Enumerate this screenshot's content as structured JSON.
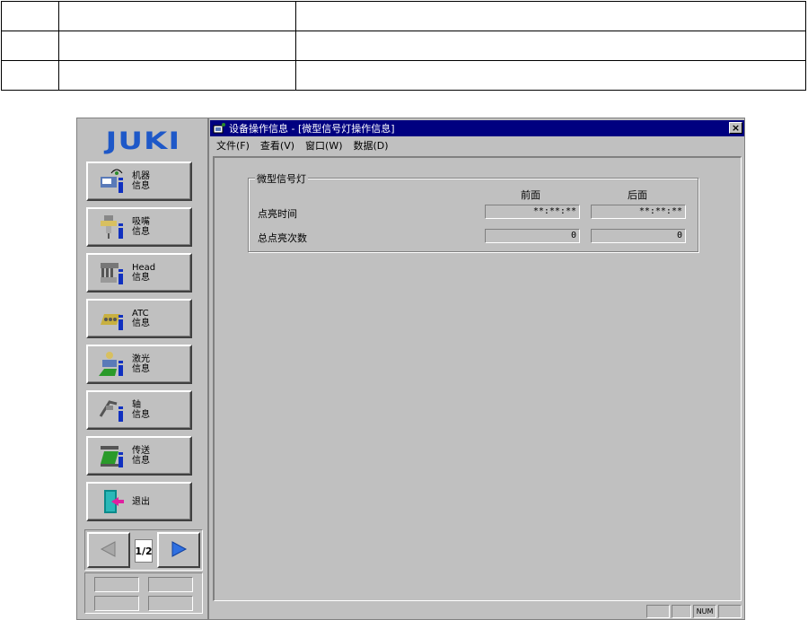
{
  "app": {
    "logo": "JUKI",
    "buttons": [
      {
        "label": "机器\n信息",
        "icon": "machine-info-icon"
      },
      {
        "label": "吸嘴\n信息",
        "icon": "nozzle-info-icon"
      },
      {
        "label": "Head\n信息",
        "icon": "head-info-icon"
      },
      {
        "label": "ATC\n信息",
        "icon": "atc-info-icon"
      },
      {
        "label": "激光\n信息",
        "icon": "laser-info-icon"
      },
      {
        "label": "轴\n信息",
        "icon": "axis-info-icon"
      },
      {
        "label": "传送\n信息",
        "icon": "conveyor-info-icon"
      },
      {
        "label": "退出",
        "icon": "exit-door-icon"
      }
    ],
    "page_indicator": "1/2"
  },
  "window": {
    "title": "设备操作信息 - [微型信号灯操作信息]",
    "close": "×",
    "menu": [
      "文件(F)",
      "查看(V)",
      "窗口(W)",
      "数据(D)"
    ]
  },
  "group": {
    "title": "微型信号灯",
    "col_front": "前面",
    "col_rear": "后面",
    "rows": [
      {
        "label": "点亮时间",
        "front": "**:**:**",
        "rear": "**:**:**"
      },
      {
        "label": "总点亮次数",
        "front": "0",
        "rear": "0"
      }
    ]
  },
  "status": {
    "num": "NUM"
  },
  "colors": {
    "titlebar": "#000080",
    "face": "#c0c0c0",
    "logo": "#1e58c8"
  }
}
